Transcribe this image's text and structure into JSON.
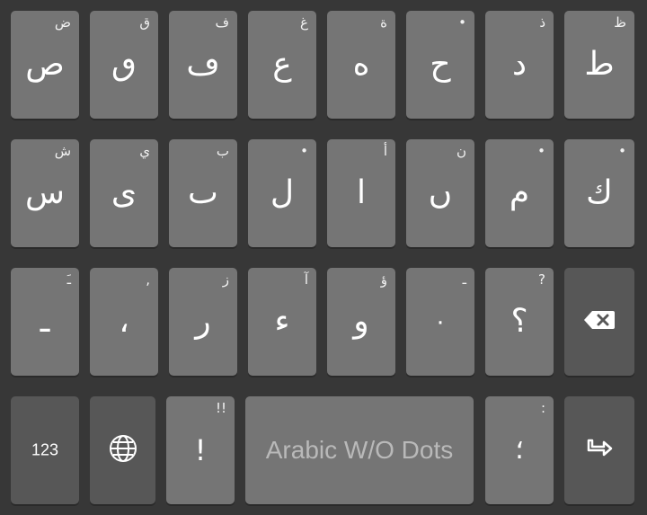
{
  "keyboard": {
    "layout_name": "Arabic W/O Dots",
    "row1": [
      {
        "main": "ص",
        "hint": "ض"
      },
      {
        "main": "ٯ",
        "hint": "ق"
      },
      {
        "main": "ڡ",
        "hint": "ف"
      },
      {
        "main": "ع",
        "hint": "غ"
      },
      {
        "main": "ه",
        "hint": "ة"
      },
      {
        "main": "ح",
        "hint": "•"
      },
      {
        "main": "د",
        "hint": "ذ"
      },
      {
        "main": "ط",
        "hint": "ظ"
      }
    ],
    "row2": [
      {
        "main": "س",
        "hint": "ش"
      },
      {
        "main": "ى",
        "hint": "ي"
      },
      {
        "main": "ٮ",
        "hint": "ب"
      },
      {
        "main": "ل",
        "hint": "•"
      },
      {
        "main": "ا",
        "hint": "أ"
      },
      {
        "main": "ں",
        "hint": "ن"
      },
      {
        "main": "م",
        "hint": "•"
      },
      {
        "main": "ك",
        "hint": "•"
      }
    ],
    "row3": [
      {
        "main": "ـ",
        "hint": "ـَ"
      },
      {
        "main": "،",
        "hint": ","
      },
      {
        "main": "ر",
        "hint": "ز"
      },
      {
        "main": "ء",
        "hint": "آ"
      },
      {
        "main": "و",
        "hint": "ؤ"
      },
      {
        "main": "٠",
        "hint": "ـ"
      },
      {
        "main": "؟",
        "hint": "?"
      }
    ],
    "row4": {
      "numbers_label": "123",
      "exclaim": {
        "main": "!",
        "hint": "!!"
      },
      "semicolon": {
        "main": "؛",
        "hint": ":"
      }
    },
    "icons": {
      "backspace": "backspace-icon",
      "language": "globe-icon",
      "enter": "enter-arrow-icon"
    },
    "colors": {
      "background": "#373737",
      "key": "#757575",
      "function_key": "#575757",
      "text": "#ffffff"
    }
  }
}
